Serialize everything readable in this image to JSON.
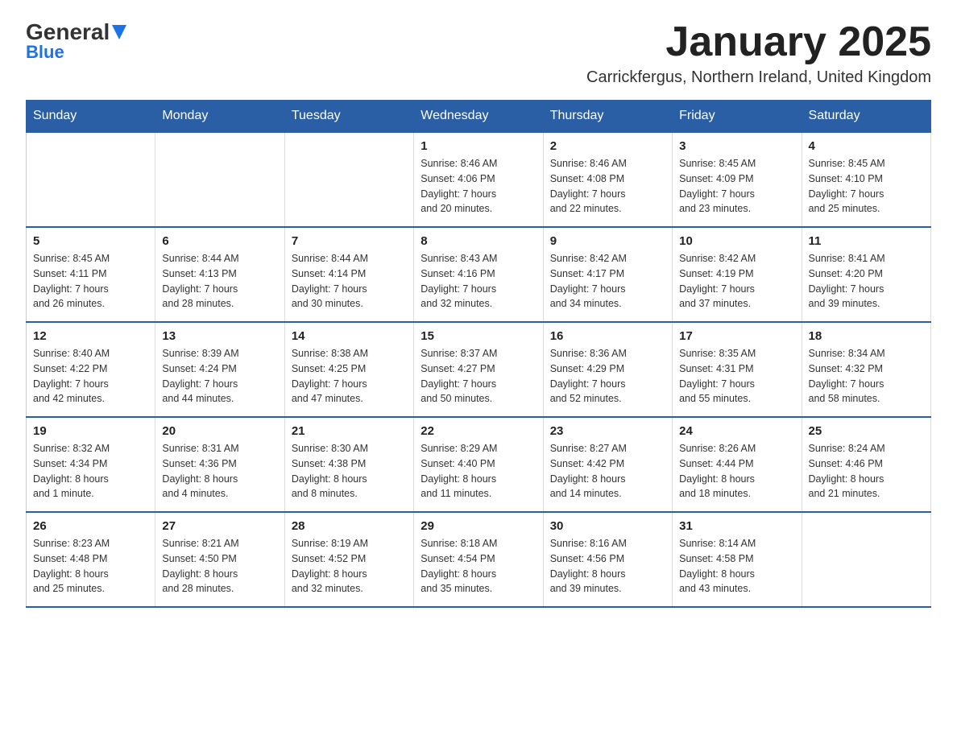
{
  "header": {
    "logo_part1": "General",
    "logo_part2": "Blue",
    "month_year": "January 2025",
    "location": "Carrickfergus, Northern Ireland, United Kingdom"
  },
  "days_of_week": [
    "Sunday",
    "Monday",
    "Tuesday",
    "Wednesday",
    "Thursday",
    "Friday",
    "Saturday"
  ],
  "weeks": [
    [
      {
        "day": "",
        "info": ""
      },
      {
        "day": "",
        "info": ""
      },
      {
        "day": "",
        "info": ""
      },
      {
        "day": "1",
        "info": "Sunrise: 8:46 AM\nSunset: 4:06 PM\nDaylight: 7 hours\nand 20 minutes."
      },
      {
        "day": "2",
        "info": "Sunrise: 8:46 AM\nSunset: 4:08 PM\nDaylight: 7 hours\nand 22 minutes."
      },
      {
        "day": "3",
        "info": "Sunrise: 8:45 AM\nSunset: 4:09 PM\nDaylight: 7 hours\nand 23 minutes."
      },
      {
        "day": "4",
        "info": "Sunrise: 8:45 AM\nSunset: 4:10 PM\nDaylight: 7 hours\nand 25 minutes."
      }
    ],
    [
      {
        "day": "5",
        "info": "Sunrise: 8:45 AM\nSunset: 4:11 PM\nDaylight: 7 hours\nand 26 minutes."
      },
      {
        "day": "6",
        "info": "Sunrise: 8:44 AM\nSunset: 4:13 PM\nDaylight: 7 hours\nand 28 minutes."
      },
      {
        "day": "7",
        "info": "Sunrise: 8:44 AM\nSunset: 4:14 PM\nDaylight: 7 hours\nand 30 minutes."
      },
      {
        "day": "8",
        "info": "Sunrise: 8:43 AM\nSunset: 4:16 PM\nDaylight: 7 hours\nand 32 minutes."
      },
      {
        "day": "9",
        "info": "Sunrise: 8:42 AM\nSunset: 4:17 PM\nDaylight: 7 hours\nand 34 minutes."
      },
      {
        "day": "10",
        "info": "Sunrise: 8:42 AM\nSunset: 4:19 PM\nDaylight: 7 hours\nand 37 minutes."
      },
      {
        "day": "11",
        "info": "Sunrise: 8:41 AM\nSunset: 4:20 PM\nDaylight: 7 hours\nand 39 minutes."
      }
    ],
    [
      {
        "day": "12",
        "info": "Sunrise: 8:40 AM\nSunset: 4:22 PM\nDaylight: 7 hours\nand 42 minutes."
      },
      {
        "day": "13",
        "info": "Sunrise: 8:39 AM\nSunset: 4:24 PM\nDaylight: 7 hours\nand 44 minutes."
      },
      {
        "day": "14",
        "info": "Sunrise: 8:38 AM\nSunset: 4:25 PM\nDaylight: 7 hours\nand 47 minutes."
      },
      {
        "day": "15",
        "info": "Sunrise: 8:37 AM\nSunset: 4:27 PM\nDaylight: 7 hours\nand 50 minutes."
      },
      {
        "day": "16",
        "info": "Sunrise: 8:36 AM\nSunset: 4:29 PM\nDaylight: 7 hours\nand 52 minutes."
      },
      {
        "day": "17",
        "info": "Sunrise: 8:35 AM\nSunset: 4:31 PM\nDaylight: 7 hours\nand 55 minutes."
      },
      {
        "day": "18",
        "info": "Sunrise: 8:34 AM\nSunset: 4:32 PM\nDaylight: 7 hours\nand 58 minutes."
      }
    ],
    [
      {
        "day": "19",
        "info": "Sunrise: 8:32 AM\nSunset: 4:34 PM\nDaylight: 8 hours\nand 1 minute."
      },
      {
        "day": "20",
        "info": "Sunrise: 8:31 AM\nSunset: 4:36 PM\nDaylight: 8 hours\nand 4 minutes."
      },
      {
        "day": "21",
        "info": "Sunrise: 8:30 AM\nSunset: 4:38 PM\nDaylight: 8 hours\nand 8 minutes."
      },
      {
        "day": "22",
        "info": "Sunrise: 8:29 AM\nSunset: 4:40 PM\nDaylight: 8 hours\nand 11 minutes."
      },
      {
        "day": "23",
        "info": "Sunrise: 8:27 AM\nSunset: 4:42 PM\nDaylight: 8 hours\nand 14 minutes."
      },
      {
        "day": "24",
        "info": "Sunrise: 8:26 AM\nSunset: 4:44 PM\nDaylight: 8 hours\nand 18 minutes."
      },
      {
        "day": "25",
        "info": "Sunrise: 8:24 AM\nSunset: 4:46 PM\nDaylight: 8 hours\nand 21 minutes."
      }
    ],
    [
      {
        "day": "26",
        "info": "Sunrise: 8:23 AM\nSunset: 4:48 PM\nDaylight: 8 hours\nand 25 minutes."
      },
      {
        "day": "27",
        "info": "Sunrise: 8:21 AM\nSunset: 4:50 PM\nDaylight: 8 hours\nand 28 minutes."
      },
      {
        "day": "28",
        "info": "Sunrise: 8:19 AM\nSunset: 4:52 PM\nDaylight: 8 hours\nand 32 minutes."
      },
      {
        "day": "29",
        "info": "Sunrise: 8:18 AM\nSunset: 4:54 PM\nDaylight: 8 hours\nand 35 minutes."
      },
      {
        "day": "30",
        "info": "Sunrise: 8:16 AM\nSunset: 4:56 PM\nDaylight: 8 hours\nand 39 minutes."
      },
      {
        "day": "31",
        "info": "Sunrise: 8:14 AM\nSunset: 4:58 PM\nDaylight: 8 hours\nand 43 minutes."
      },
      {
        "day": "",
        "info": ""
      }
    ]
  ]
}
